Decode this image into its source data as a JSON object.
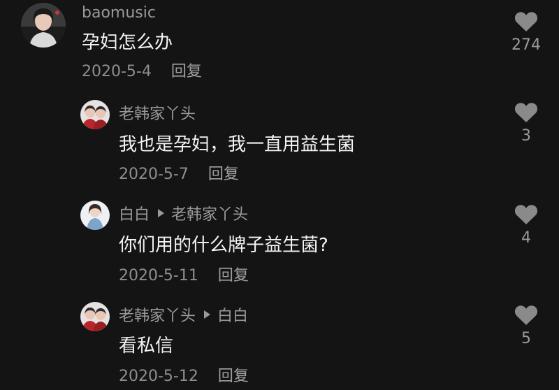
{
  "comments": [
    {
      "author": "baomusic",
      "text": "孕妇怎么办",
      "date": "2020-5-4",
      "reply_label": "回复",
      "likes": "274",
      "avatar_icon": "woman-portrait-avatar"
    },
    {
      "author": "老韩家丫头",
      "text": "我也是孕妇，我一直用益生菌",
      "date": "2020-5-7",
      "reply_label": "回复",
      "likes": "3",
      "avatar_icon": "couple-portrait-avatar"
    },
    {
      "author": "白白",
      "reply_to": "老韩家丫头",
      "text": "你们用的什么牌子益生菌?",
      "date": "2020-5-11",
      "reply_label": "回复",
      "likes": "4",
      "avatar_icon": "girl-portrait-avatar"
    },
    {
      "author": "老韩家丫头",
      "reply_to": "白白",
      "text": "看私信",
      "date": "2020-5-12",
      "reply_label": "回复",
      "likes": "5",
      "avatar_icon": "couple-portrait-avatar"
    }
  ],
  "colors": {
    "background": "#141414",
    "text": "#f4f4f4",
    "secondary": "#9a9a9a",
    "like_icon": "#8a8a8a"
  },
  "icons": {
    "like": "heart-icon",
    "reply_arrow": "play-arrow-icon"
  }
}
